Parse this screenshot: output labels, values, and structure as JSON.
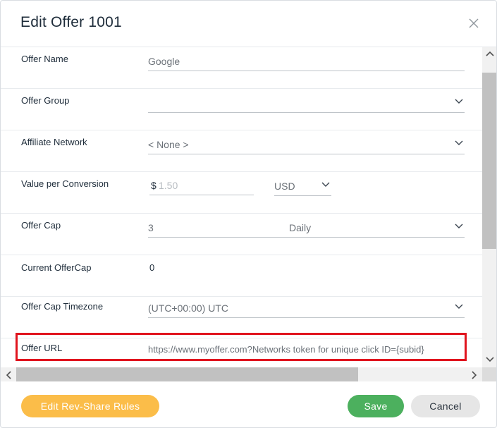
{
  "modal": {
    "title": "Edit Offer 1001"
  },
  "form": {
    "offer_name": {
      "label": "Offer Name",
      "value": "Google"
    },
    "offer_group": {
      "label": "Offer Group",
      "value": ""
    },
    "affiliate_network": {
      "label": "Affiliate Network",
      "value": "< None >"
    },
    "value_per_conversion": {
      "label": "Value per Conversion",
      "currency_symbol": "$",
      "placeholder": "1.50",
      "currency": "USD"
    },
    "offer_cap": {
      "label": "Offer Cap",
      "value": "3",
      "period": "Daily"
    },
    "current_offercap": {
      "label": "Current OfferCap",
      "value": "0"
    },
    "offer_cap_timezone": {
      "label": "Offer Cap Timezone",
      "value": "(UTC+00:00) UTC"
    },
    "offer_url": {
      "label": "Offer URL",
      "value": "https://www.myoffer.com?Networks token for unique click ID={subid}"
    }
  },
  "footer": {
    "rev_share_label": "Edit Rev-Share Rules",
    "save_label": "Save",
    "cancel_label": "Cancel"
  },
  "colors": {
    "rev_share": "#fbbd49",
    "save": "#4cb05e",
    "cancel": "#e6e6e6",
    "highlight": "#e0141e"
  },
  "icons": [
    "close-icon",
    "chevron-down-icon",
    "scroll-up-icon",
    "scroll-down-icon",
    "scroll-left-icon",
    "scroll-right-icon"
  ]
}
